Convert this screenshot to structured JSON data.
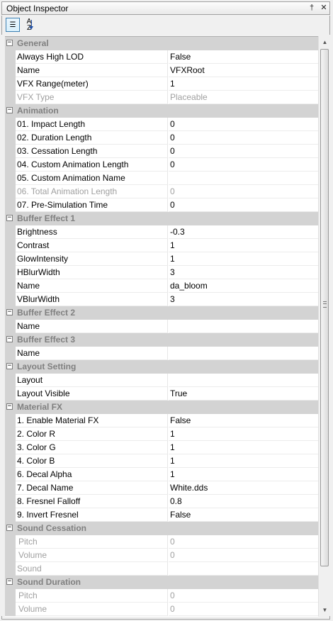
{
  "window": {
    "title": "Object Inspector",
    "pin": "†",
    "close": "✕"
  },
  "toolbar": {
    "categorized": "☰",
    "alphabetical_top": "A",
    "alphabetical_bottom": "Z"
  },
  "rows": [
    {
      "kind": "cat",
      "label": "General"
    },
    {
      "kind": "prop",
      "name": "Always High LOD",
      "value": "False"
    },
    {
      "kind": "prop",
      "name": "Name",
      "value": "VFXRoot"
    },
    {
      "kind": "prop",
      "name": "VFX Range(meter)",
      "value": "1"
    },
    {
      "kind": "prop",
      "name": "VFX Type",
      "value": "Placeable",
      "disabled": true
    },
    {
      "kind": "cat",
      "label": "Animation"
    },
    {
      "kind": "prop",
      "name": "01. Impact Length",
      "value": "0"
    },
    {
      "kind": "prop",
      "name": "02. Duration Length",
      "value": "0"
    },
    {
      "kind": "prop",
      "name": "03. Cessation Length",
      "value": "0"
    },
    {
      "kind": "prop",
      "name": "04. Custom Animation Length",
      "value": "0"
    },
    {
      "kind": "prop",
      "name": "05. Custom Animation Name",
      "value": ""
    },
    {
      "kind": "prop",
      "name": "06. Total Animation Length",
      "value": "0",
      "disabled": true
    },
    {
      "kind": "prop",
      "name": "07. Pre-Simulation Time",
      "value": "0"
    },
    {
      "kind": "cat",
      "label": "Buffer Effect 1"
    },
    {
      "kind": "prop",
      "name": "Brightness",
      "value": "-0.3"
    },
    {
      "kind": "prop",
      "name": "Contrast",
      "value": "1"
    },
    {
      "kind": "prop",
      "name": "GlowIntensity",
      "value": "1"
    },
    {
      "kind": "prop",
      "name": "HBlurWidth",
      "value": "3"
    },
    {
      "kind": "prop",
      "name": "Name",
      "value": "da_bloom"
    },
    {
      "kind": "prop",
      "name": "VBlurWidth",
      "value": "3"
    },
    {
      "kind": "cat",
      "label": "Buffer Effect 2"
    },
    {
      "kind": "prop",
      "name": "Name",
      "value": ""
    },
    {
      "kind": "cat",
      "label": "Buffer Effect 3"
    },
    {
      "kind": "prop",
      "name": "Name",
      "value": ""
    },
    {
      "kind": "cat",
      "label": "Layout Setting"
    },
    {
      "kind": "prop",
      "name": "Layout",
      "value": ""
    },
    {
      "kind": "prop",
      "name": "Layout Visible",
      "value": "True"
    },
    {
      "kind": "cat",
      "label": "Material FX"
    },
    {
      "kind": "prop",
      "name": "1. Enable Material FX",
      "value": "False"
    },
    {
      "kind": "prop",
      "name": "2. Color R",
      "value": "1"
    },
    {
      "kind": "prop",
      "name": "3. Color G",
      "value": "1"
    },
    {
      "kind": "prop",
      "name": "4. Color B",
      "value": "1"
    },
    {
      "kind": "prop",
      "name": "6. Decal Alpha",
      "value": "1"
    },
    {
      "kind": "prop",
      "name": "7. Decal Name",
      "value": "White.dds"
    },
    {
      "kind": "prop",
      "name": "8. Fresnel Falloff",
      "value": "0.8"
    },
    {
      "kind": "prop",
      "name": "9. Invert Fresnel",
      "value": "False"
    },
    {
      "kind": "cat",
      "label": "Sound Cessation"
    },
    {
      "kind": "prop",
      "name": "Pitch",
      "value": "0",
      "disabled": true,
      "sub": true
    },
    {
      "kind": "prop",
      "name": "Volume",
      "value": "0",
      "disabled": true,
      "sub": true
    },
    {
      "kind": "prop",
      "name": "Sound",
      "value": "",
      "disabled": true
    },
    {
      "kind": "cat",
      "label": "Sound Duration"
    },
    {
      "kind": "prop",
      "name": "Pitch",
      "value": "0",
      "disabled": true,
      "sub": true
    },
    {
      "kind": "prop",
      "name": "Volume",
      "value": "0",
      "disabled": true,
      "sub": true
    }
  ]
}
